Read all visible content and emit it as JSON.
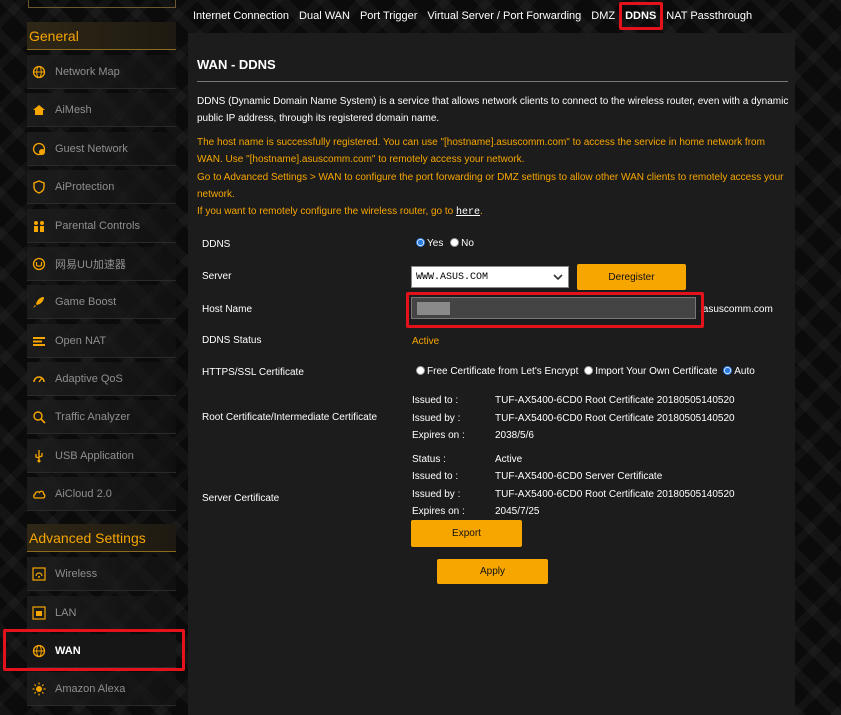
{
  "sidebar": {
    "general_header": "General",
    "advanced_header": "Advanced Settings",
    "general_items": [
      {
        "label": "Network Map",
        "icon": "globe-icon"
      },
      {
        "label": "AiMesh",
        "icon": "home-mesh-icon"
      },
      {
        "label": "Guest Network",
        "icon": "guest-network-icon"
      },
      {
        "label": "AiProtection",
        "icon": "shield-icon"
      },
      {
        "label": "Parental Controls",
        "icon": "family-icon"
      },
      {
        "label": "网易UU加速器",
        "icon": "uu-accelerator-icon"
      },
      {
        "label": "Game Boost",
        "icon": "rocket-icon"
      },
      {
        "label": "Open NAT",
        "icon": "open-nat-icon"
      },
      {
        "label": "Adaptive QoS",
        "icon": "gauge-icon"
      },
      {
        "label": "Traffic Analyzer",
        "icon": "traffic-analyzer-icon"
      },
      {
        "label": "USB Application",
        "icon": "usb-icon"
      },
      {
        "label": "AiCloud 2.0",
        "icon": "cloud-icon"
      }
    ],
    "advanced_items": [
      {
        "label": "Wireless",
        "icon": "wireless-icon"
      },
      {
        "label": "LAN",
        "icon": "lan-icon"
      },
      {
        "label": "WAN",
        "icon": "wan-globe-icon"
      },
      {
        "label": "Amazon Alexa",
        "icon": "alexa-icon"
      }
    ]
  },
  "tabs": [
    {
      "label": "Internet Connection"
    },
    {
      "label": "Dual WAN"
    },
    {
      "label": "Port Trigger"
    },
    {
      "label": "Virtual Server / Port Forwarding"
    },
    {
      "label": "DMZ"
    },
    {
      "label": "DDNS"
    },
    {
      "label": "NAT Passthrough"
    }
  ],
  "main": {
    "title": "WAN - DDNS",
    "description": "DDNS (Dynamic Domain Name System) is a service that allows network clients to connect to the wireless router, even with a dynamic public IP address, through its registered domain name.",
    "notice_1": "The host name is successfully registered. You can use \"[hostname].asuscomm.com\" to access the service in home network from WAN. Use \"[hostname].asuscomm.com\" to remotely access your network.",
    "notice_2": "Go to Advanced Settings > WAN to configure the port forwarding or DMZ settings to allow other WAN clients to remotely access your network.",
    "notice_3_prefix": "If you want to remotely configure the wireless router, go to ",
    "notice_3_link": "here",
    "notice_3_suffix": ".",
    "ddns_label": "DDNS",
    "ddns_yes": "Yes",
    "ddns_no": "No",
    "server_label": "Server",
    "server_value": "WWW.ASUS.COM",
    "deregister_label": "Deregister",
    "hostname_label": "Host Name",
    "hostname_suffix": ".asuscomm.com",
    "status_label": "DDNS Status",
    "status_value": "Active",
    "https_label": "HTTPS/SSL Certificate",
    "cert_opt_free": "Free Certificate from Let's Encrypt",
    "cert_opt_import": "Import Your Own Certificate",
    "cert_opt_auto": "Auto",
    "root_cert_label": "Root Certificate/Intermediate Certificate",
    "root_cert": [
      {
        "key": "Issued to :",
        "value": "TUF-AX5400-6CD0 Root Certificate 20180505140520"
      },
      {
        "key": "Issued by :",
        "value": "TUF-AX5400-6CD0 Root Certificate 20180505140520"
      },
      {
        "key": "Expires on :",
        "value": "2038/5/6"
      }
    ],
    "server_cert_label": "Server Certificate",
    "server_cert": [
      {
        "key": "Status :",
        "value": "Active"
      },
      {
        "key": "Issued to :",
        "value": "TUF-AX5400-6CD0 Server Certificate"
      },
      {
        "key": "Issued by :",
        "value": "TUF-AX5400-6CD0 Root Certificate 20180505140520"
      },
      {
        "key": "Expires on :",
        "value": "2045/7/25"
      }
    ],
    "export_label": "Export",
    "apply_label": "Apply"
  },
  "colors": {
    "accent": "#f7a600",
    "highlight": "#e3121b",
    "radio_selected": "#2c7be0"
  }
}
